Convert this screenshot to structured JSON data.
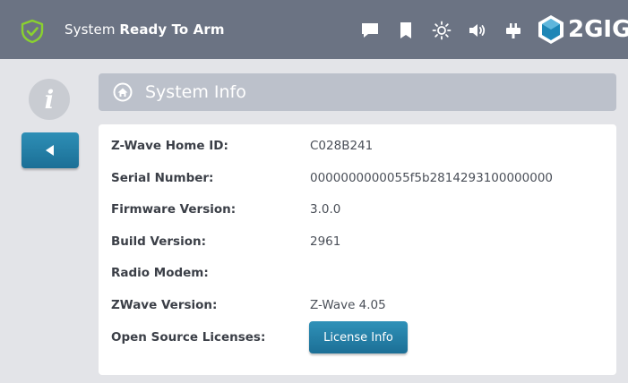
{
  "status_bar": {
    "status_prefix": "System ",
    "status_bold": "Ready To Arm",
    "brand": "2GIG",
    "icons": [
      "shield-check-icon",
      "message-icon",
      "bookmark-icon",
      "brightness-icon",
      "volume-icon",
      "power-plug-icon"
    ],
    "colors": {
      "bar": "#6b7383",
      "shield_green": "#8ad12f",
      "brand_accent": "#1d86b6"
    }
  },
  "sidebar": {
    "info_icon": "i",
    "back_icon": "back-arrow-icon"
  },
  "section": {
    "title": "System Info",
    "icon": "home-circle-icon"
  },
  "info": {
    "rows": [
      {
        "label": "Z-Wave Home ID:",
        "value": "C028B241"
      },
      {
        "label": "Serial Number:",
        "value": "0000000000055f5b2814293100000000"
      },
      {
        "label": "Firmware Version:",
        "value": "3.0.0"
      },
      {
        "label": "Build Version:",
        "value": "2961"
      },
      {
        "label": "Radio Modem:",
        "value": ""
      },
      {
        "label": "ZWave Version:",
        "value": "Z-Wave 4.05"
      },
      {
        "label": "Open Source Licenses:",
        "value": ""
      }
    ],
    "license_button": "License Info",
    "button_color": "#1f7aa3"
  }
}
